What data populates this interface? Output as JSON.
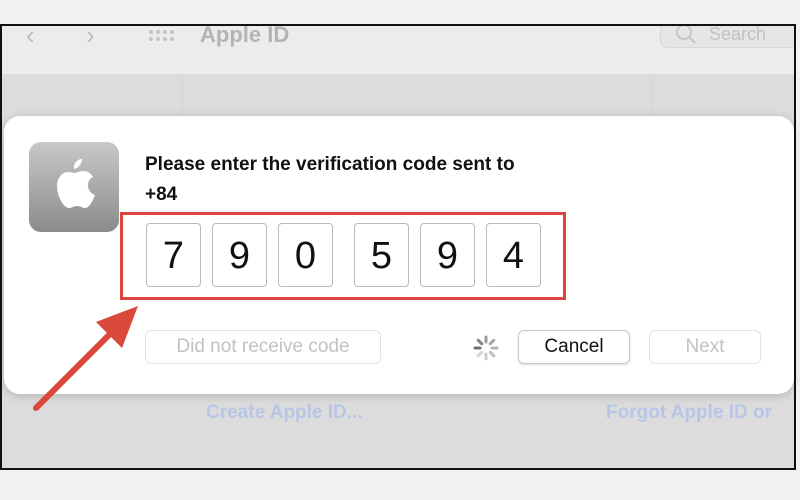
{
  "background": {
    "window_title": "Apple ID",
    "search_placeholder": "Search",
    "create_link": "Create Apple ID...",
    "forgot_link": "Forgot Apple ID or"
  },
  "dialog": {
    "message_line1": "Please enter the verification code sent to",
    "message_line2": "+84",
    "code_digits": [
      "7",
      "9",
      "0",
      "5",
      "9",
      "4"
    ],
    "did_not_receive_label": "Did not receive code",
    "cancel_label": "Cancel",
    "next_label": "Next",
    "highlight_color": "#d9483b",
    "app_icon": "apple-logo-icon",
    "loading_icon": "spinner-icon"
  }
}
